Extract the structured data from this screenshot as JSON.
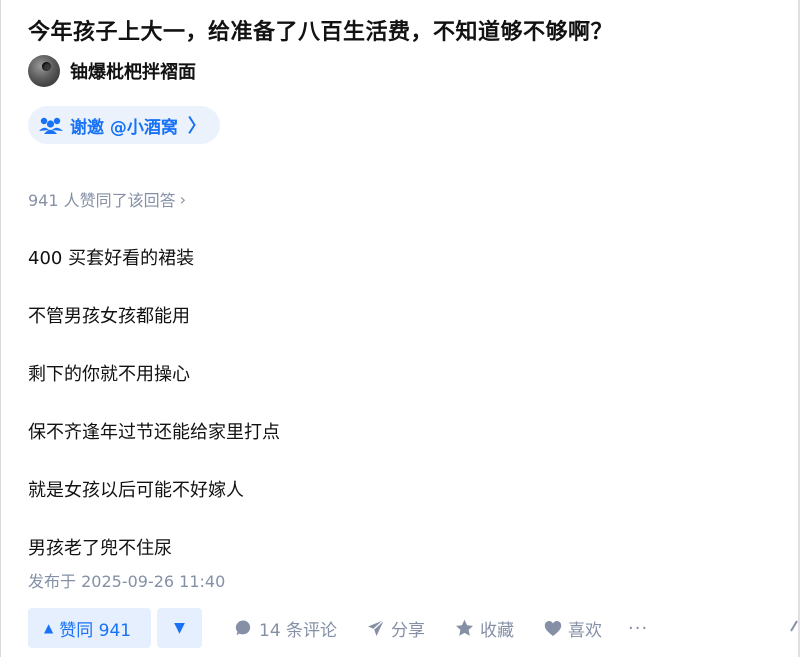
{
  "question": {
    "title": "今年孩子上大一，给准备了八百生活费，不知道够不够啊？"
  },
  "author": {
    "name": "铀爆枇杷拌褶面"
  },
  "invite": {
    "label": "谢邀 @小酒窝",
    "chevron": "〉"
  },
  "answer": {
    "upvote_summary": "941 人赞同了该回答",
    "summary_chevron": "›",
    "lines": [
      "400 买套好看的裙装",
      "不管男孩女孩都能用",
      "剩下的你就不用操心",
      "保不齐逢年过节还能给家里打点",
      "就是女孩以后可能不好嫁人",
      "男孩老了兜不住尿"
    ],
    "published": "发布于 2025-09-26 11:40"
  },
  "actions": {
    "upvote_label": "赞同 941",
    "upvote_glyph": "▲",
    "downvote_glyph": "▼",
    "comments": "14 条评论",
    "share": "分享",
    "favorite": "收藏",
    "like": "喜欢",
    "more": "···"
  },
  "colors": {
    "accent": "#1772f6",
    "accent_bg": "#e5effd",
    "muted": "#8590a6",
    "text": "#121212"
  },
  "icons": [
    "people-icon",
    "comment-icon",
    "share-icon",
    "star-icon",
    "heart-icon",
    "more-icon"
  ]
}
